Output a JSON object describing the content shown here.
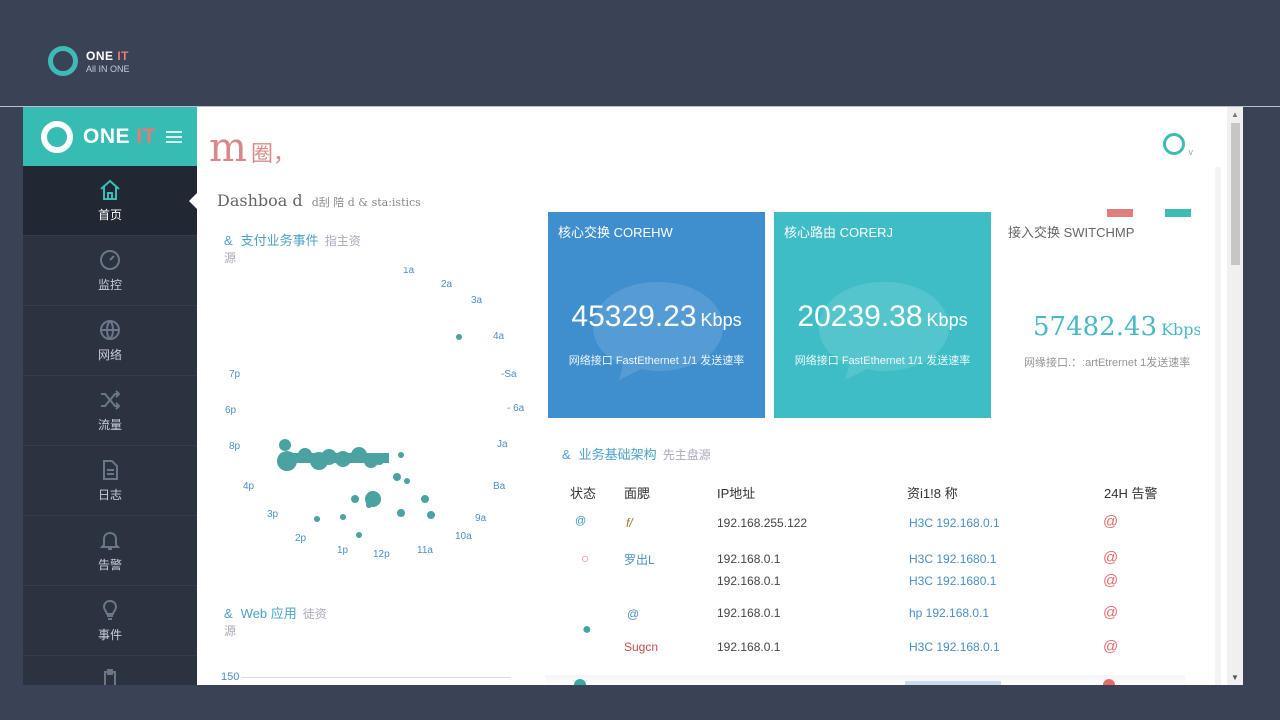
{
  "topbar": {
    "brand": "ONE ",
    "brand_accent": "IT",
    "tagline": "All IN ONE"
  },
  "sidebar": {
    "brand": "ONE ",
    "brand_accent": "IT",
    "items": [
      {
        "label": "首页",
        "icon": "home-icon",
        "active": true
      },
      {
        "label": "监控",
        "icon": "gauge-icon"
      },
      {
        "label": "网络",
        "icon": "globe-icon"
      },
      {
        "label": "流量",
        "icon": "shuffle-icon"
      },
      {
        "label": "日志",
        "icon": "document-icon"
      },
      {
        "label": "告警",
        "icon": "bell-icon"
      },
      {
        "label": "事件",
        "icon": "lightbulb-icon"
      }
    ]
  },
  "header": {
    "title_big": "m",
    "title_small": "圈，"
  },
  "dashboard": {
    "title": "Dashboa d",
    "subtitle": "d刮  陪     d & sta:istics"
  },
  "payment_section": {
    "amp": "&",
    "title": "支付业务事件",
    "hint": "指主资",
    "hint2": "源"
  },
  "clock_labels": [
    "1a",
    "2a",
    "3a",
    "4a",
    "-Sa",
    "- 6a",
    "Ja",
    "Ba",
    "9a",
    "10a",
    "11a",
    "12p",
    "1p",
    "2p",
    "3p",
    "4p",
    "8p",
    "6p",
    "7p"
  ],
  "web_section": {
    "amp": "&",
    "title": "Web 应用",
    "hint": "徒资",
    "hint2": "源"
  },
  "web_chart": {
    "ymax_label": "150"
  },
  "cards": [
    {
      "title": "核心交换 COREHW",
      "value": "45329.23",
      "unit": "Kbps",
      "desc": "网络接口 FastEthernet 1/1 发送速率"
    },
    {
      "title": "核心路由 CORERJ",
      "value": "20239.38",
      "unit": "Kbps",
      "desc": "网络接口 FastEthernet 1/1 发送速率"
    },
    {
      "title": "接入交换  SWITCHMP",
      "value": "57482.43",
      "unit": "Kbps",
      "desc": "网缘接口.：ːartEtrernet   1发送速率"
    }
  ],
  "infra_section": {
    "amp": "&",
    "title": "业务基础架构",
    "hint": "先主盘源"
  },
  "table": {
    "headers": [
      "状态",
      "面腮",
      "IP地址",
      "资i1!8 称",
      "24H 告警"
    ],
    "rows": [
      {
        "status": "@",
        "name": "f/",
        "ip": "192.168.255.122",
        "device": "H3C  192.168.0.1",
        "alarm": "@"
      },
      {
        "status": "○",
        "name": "罗出L",
        "ip": "192.168.0.1",
        "device": "H3C  192.1680.1",
        "alarm": "@"
      },
      {
        "status": "",
        "name": "",
        "ip": "192.168.0.1",
        "device": "H3C  192.1680.1",
        "alarm": "@"
      },
      {
        "status": "●",
        "name": "@",
        "ip": "192.168.0.1",
        "device": "hp  192.168.0.1",
        "alarm": "@"
      },
      {
        "status": "",
        "name": "Sugcn",
        "ip": "192.168.0.1",
        "device": "H3C  192.168.0.1",
        "alarm": "@"
      }
    ]
  },
  "colors": {
    "accent": "#3dbcb6",
    "blue_card": "#3f8fcf",
    "teal_card": "#3ebdc7",
    "alert": "#e56a6a",
    "sidebar": "#2b3240"
  }
}
